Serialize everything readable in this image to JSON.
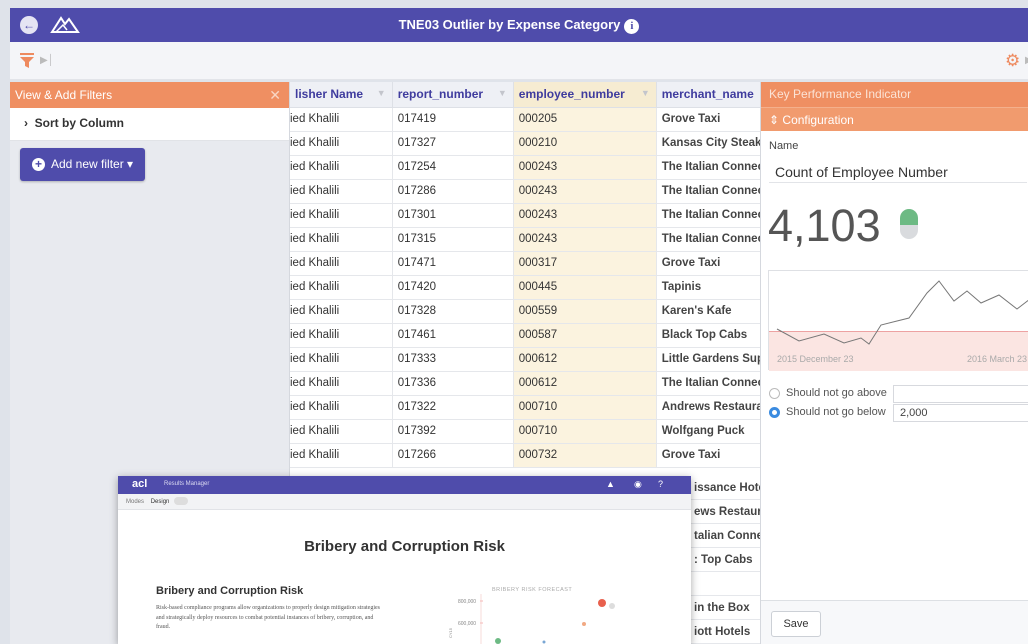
{
  "header": {
    "title": "TNE03 Outlier by Expense Category",
    "info_icon": "info-icon"
  },
  "filters": {
    "title": "View & Add Filters",
    "sort_label": "Sort by Column",
    "add_filter_label": "Add new filter"
  },
  "table": {
    "columns": [
      "lisher Name",
      "report_number",
      "employee_number",
      "merchant_name"
    ],
    "rows": [
      [
        "ied Khalili",
        "017419",
        "000205",
        "Grove Taxi"
      ],
      [
        "ied Khalili",
        "017327",
        "000210",
        "Kansas City Steak"
      ],
      [
        "ied Khalili",
        "017254",
        "000243",
        "The Italian Connec"
      ],
      [
        "ied Khalili",
        "017286",
        "000243",
        "The Italian Connec"
      ],
      [
        "ied Khalili",
        "017301",
        "000243",
        "The Italian Connec"
      ],
      [
        "ied Khalili",
        "017315",
        "000243",
        "The Italian Connec"
      ],
      [
        "ied Khalili",
        "017471",
        "000317",
        "Grove Taxi"
      ],
      [
        "ied Khalili",
        "017420",
        "000445",
        "Tapinis"
      ],
      [
        "ied Khalili",
        "017328",
        "000559",
        "Karen's Kafe"
      ],
      [
        "ied Khalili",
        "017461",
        "000587",
        "Black Top Cabs"
      ],
      [
        "ied Khalili",
        "017333",
        "000612",
        "Little Gardens Sup"
      ],
      [
        "ied Khalili",
        "017336",
        "000612",
        "The Italian Connec"
      ],
      [
        "ied Khalili",
        "017322",
        "000710",
        "Andrews Restaura"
      ],
      [
        "ied Khalili",
        "017392",
        "000710",
        "Wolfgang Puck"
      ],
      [
        "ied Khalili",
        "017266",
        "000732",
        "Grove Taxi"
      ]
    ],
    "hidden_rows_merchant": [
      "issance Hotel",
      "ews Restaura",
      "talian Connec",
      ": Top Cabs",
      "",
      "in the Box",
      "iott Hotels"
    ]
  },
  "kpi": {
    "title": "Key Performance Indicator",
    "section": "Configuration",
    "name_label": "Name",
    "name_value": "Count of Employee Number",
    "value": "4,103",
    "date_start": "2015 December 23",
    "date_end": "2016 March 23",
    "above_label": "Should not go above",
    "above_value": "",
    "below_label": "Should not go below",
    "below_value": "2,000",
    "save_label": "Save",
    "status_color": "#6dba84"
  },
  "results_manager": {
    "app_label": "Results Manager",
    "logo": "acl",
    "modes_label": "Modes",
    "design_label": "Design",
    "page_title": "Bribery and Corruption Risk",
    "section_title": "Bribery and Corruption Risk",
    "paragraph": "Risk-based compliance programs allow organizations to properly design mitigation strategies and strategically deploy resources to combat potential instances of bribery, corruption, and fraud.",
    "chart_title": "BRIBERY RISK FORECAST",
    "chart_ticks": [
      "800,000",
      "600,000"
    ],
    "chart_axis": "CY15"
  }
}
